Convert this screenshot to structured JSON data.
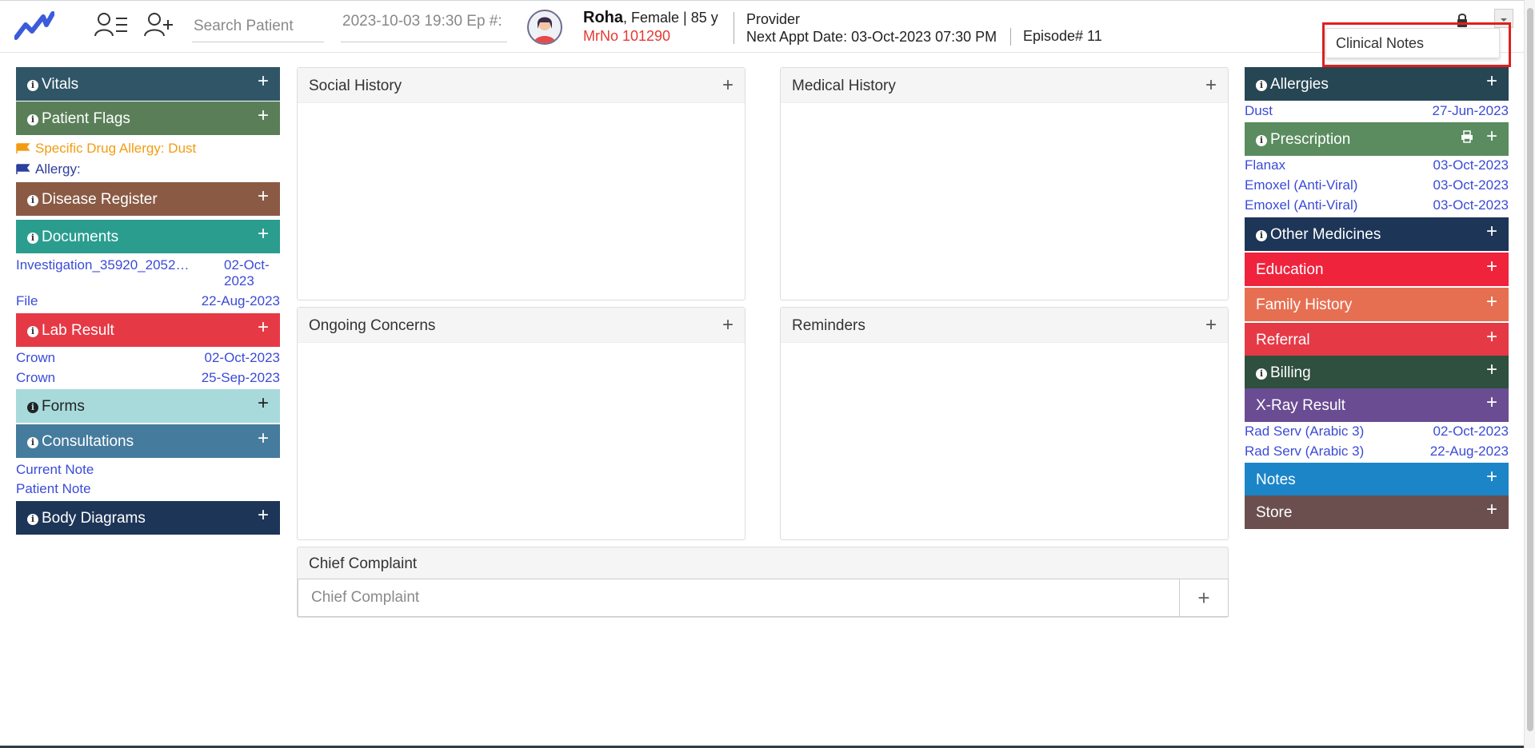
{
  "header": {
    "search_placeholder": "Search Patient",
    "episode_label": "2023-10-03 19:30 Ep #:",
    "patient_name": "Roha",
    "patient_meta": ", Female | 85 y",
    "mrno": "MrNo 101290",
    "provider_label": "Provider",
    "next_appt_label": "Next Appt Date",
    "next_appt_value": ": 03-Oct-2023 07:30 PM",
    "episode_no": "Episode# 11",
    "dropdown_item": "Clinical Notes"
  },
  "left": {
    "vitals": "Vitals",
    "patient_flags": "Patient Flags",
    "flags": [
      {
        "text": "Specific Drug Allergy: Dust",
        "color": "#f39c12"
      },
      {
        "text": "Allergy:",
        "color": "#2c3e9e"
      }
    ],
    "disease_register": "Disease Register",
    "documents": "Documents",
    "document_items": [
      {
        "name": "Investigation_35920_2052…",
        "date": "02-Oct-2023"
      },
      {
        "name": "File",
        "date": "22-Aug-2023"
      }
    ],
    "lab_result": "Lab Result",
    "lab_items": [
      {
        "name": "Crown",
        "date": "02-Oct-2023"
      },
      {
        "name": "Crown",
        "date": "25-Sep-2023"
      }
    ],
    "forms": "Forms",
    "consultations": "Consultations",
    "consultation_items": [
      "Current Note",
      "Patient Note"
    ],
    "body_diagrams": "Body Diagrams"
  },
  "center": {
    "social_history": "Social History",
    "medical_history": "Medical History",
    "ongoing_concerns": "Ongoing Concerns",
    "reminders": "Reminders",
    "chief_complaint": "Chief Complaint",
    "chief_complaint_placeholder": "Chief Complaint",
    "plus": "+"
  },
  "right": {
    "allergies": "Allergies",
    "allergy_items": [
      {
        "name": "Dust",
        "date": "27-Jun-2023"
      }
    ],
    "prescription": "Prescription",
    "prescription_items": [
      {
        "name": "Flanax",
        "date": "03-Oct-2023"
      },
      {
        "name": "Emoxel (Anti-Viral)",
        "date": "03-Oct-2023"
      },
      {
        "name": "Emoxel (Anti-Viral)",
        "date": "03-Oct-2023"
      }
    ],
    "other_medicines": "Other Medicines",
    "education": "Education",
    "family_history": "Family History",
    "referral": "Referral",
    "billing": "Billing",
    "xray_result": "X-Ray Result",
    "xray_items": [
      {
        "name": "Rad Serv (Arabic 3)",
        "date": "02-Oct-2023"
      },
      {
        "name": "Rad Serv (Arabic 3)",
        "date": "22-Aug-2023"
      }
    ],
    "notes": "Notes",
    "store": "Store"
  },
  "colors": {
    "vitals": "#2f5567",
    "patient_flags": "#5a7f58",
    "disease_register": "#8a5a44",
    "documents": "#2a9d8f",
    "lab_result": "#e63946",
    "forms": "#a8dadc",
    "consultations": "#457b9d",
    "body_diagrams": "#1d3557",
    "allergies": "#264653",
    "prescription": "#5a8c5f",
    "other_medicines": "#1d3557",
    "education": "#ef233c",
    "family_history": "#e76f51",
    "referral": "#e63946",
    "billing": "#2f4f3f",
    "xray_result": "#6a4c93",
    "notes": "#1b85c8",
    "store": "#6b4f4f",
    "link": "#3b4bd8",
    "highlight": "#e0201f"
  }
}
